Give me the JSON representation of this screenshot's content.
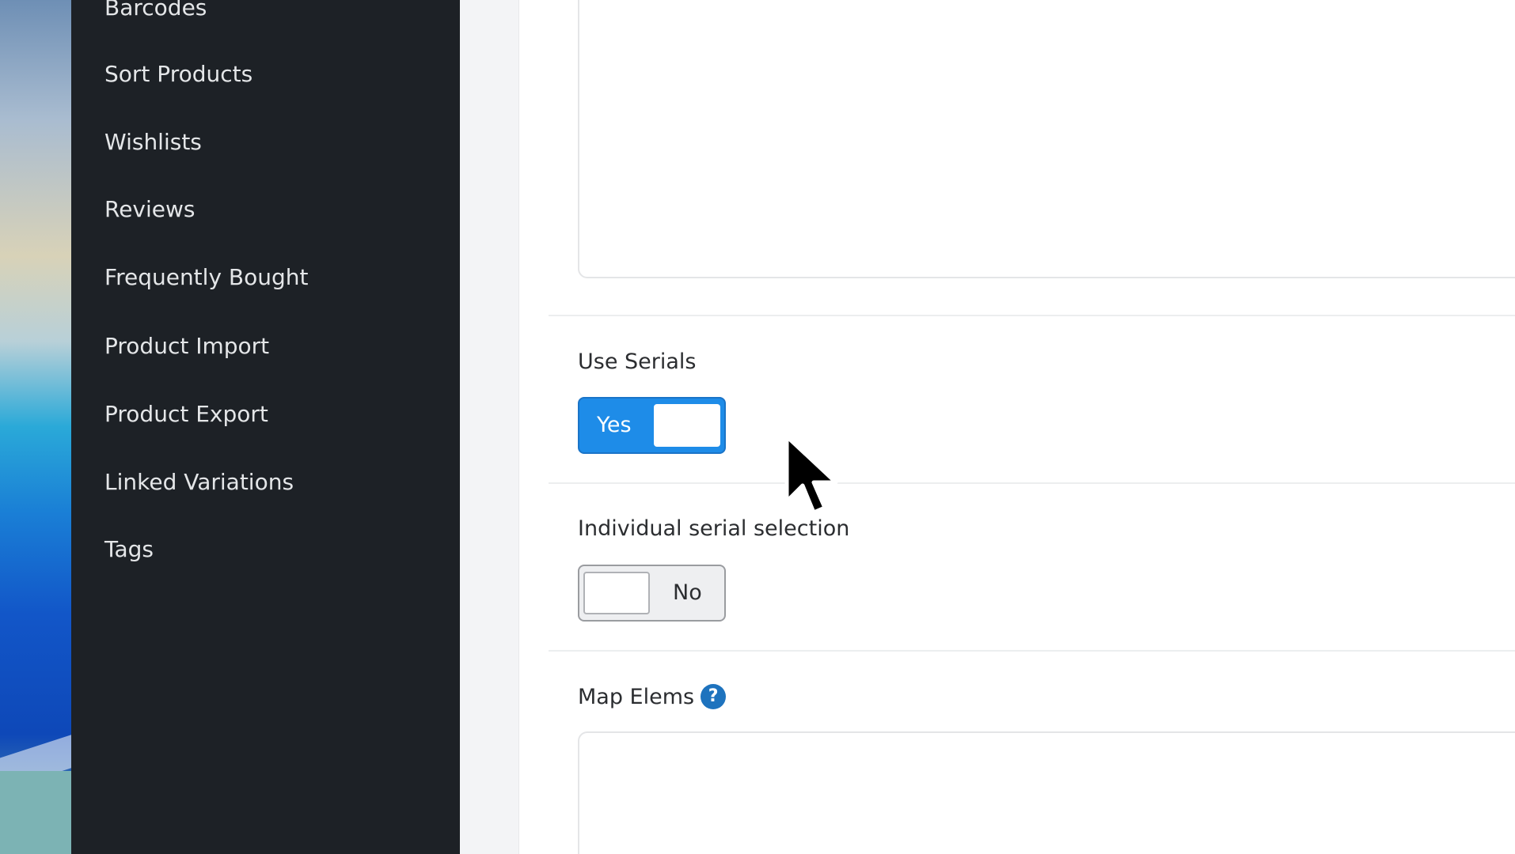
{
  "sidebar": {
    "items": [
      {
        "label": "Barcodes"
      },
      {
        "label": "Sort Products"
      },
      {
        "label": "Wishlists"
      },
      {
        "label": "Reviews"
      },
      {
        "label": "Frequently Bought"
      },
      {
        "label": "Product Import"
      },
      {
        "label": "Product Export"
      },
      {
        "label": "Linked Variations"
      },
      {
        "label": "Tags"
      }
    ]
  },
  "form": {
    "use_serials": {
      "label": "Use Serials",
      "toggle_text": "Yes",
      "enabled": true
    },
    "individual_serial_selection": {
      "label": "Individual serial selection",
      "toggle_text": "No",
      "enabled": false
    },
    "map_elems": {
      "label": "Map Elems",
      "help_glyph": "?"
    }
  },
  "colors": {
    "sidebar_bg": "#1d2126",
    "toggle_on": "#1e8ce8",
    "help_icon": "#1e73be"
  },
  "icons": {
    "help": "question-circle-icon",
    "cursor": "mouse-pointer-icon"
  }
}
